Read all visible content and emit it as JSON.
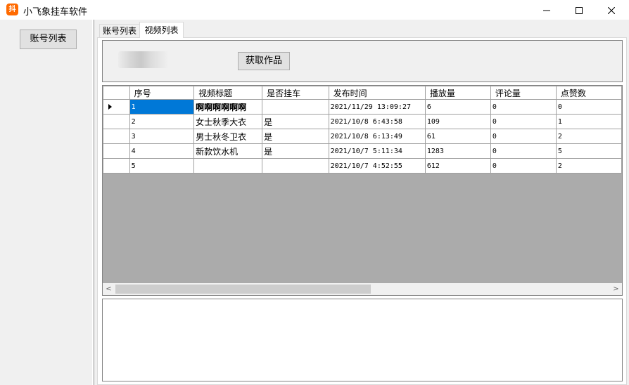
{
  "window": {
    "title": "小飞象挂车软件",
    "icon_text": "抖"
  },
  "sidebar": {
    "accounts_button": "账号列表"
  },
  "tabs": [
    {
      "label": "账号列表",
      "active": false
    },
    {
      "label": "视频列表",
      "active": true
    }
  ],
  "toolbar": {
    "get_works_button": "获取作品"
  },
  "grid": {
    "columns": [
      "序号",
      "视频标题",
      "是否挂车",
      "发布时间",
      "播放量",
      "评论量",
      "点赞数"
    ],
    "rows": [
      {
        "index": "1",
        "title": "啊啊啊啊啊啊",
        "has_cart": "",
        "published": "2021/11/29 13:09:27",
        "plays": "6",
        "comments": "0",
        "likes": "0",
        "current": true
      },
      {
        "index": "2",
        "title": "女士秋季大衣",
        "has_cart": "是",
        "published": "2021/10/8 6:43:58",
        "plays": "109",
        "comments": "0",
        "likes": "1",
        "current": false
      },
      {
        "index": "3",
        "title": "男士秋冬卫衣",
        "has_cart": "是",
        "published": "2021/10/8 6:13:49",
        "plays": "61",
        "comments": "0",
        "likes": "2",
        "current": false
      },
      {
        "index": "4",
        "title": "新款饮水机",
        "has_cart": "是",
        "published": "2021/10/7 5:11:34",
        "plays": "1283",
        "comments": "0",
        "likes": "5",
        "current": false
      },
      {
        "index": "5",
        "title": "",
        "has_cart": "",
        "published": "2021/10/7 4:52:55",
        "plays": "612",
        "comments": "0",
        "likes": "2",
        "current": false
      }
    ],
    "scroll_arrows": {
      "left": "<",
      "right": ">"
    }
  },
  "colors": {
    "selection": "#0078d7",
    "app_icon": "#ff6a00"
  }
}
